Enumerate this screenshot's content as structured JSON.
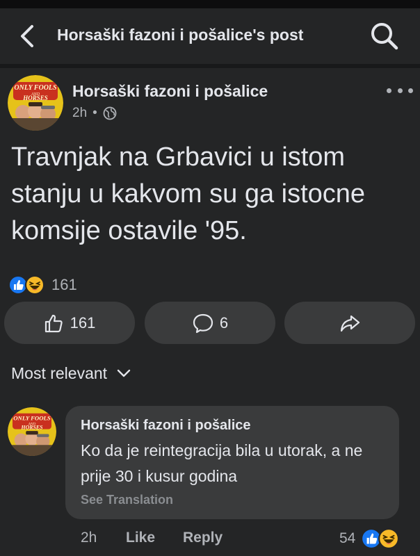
{
  "header": {
    "title": "Horsaški fazoni i pošalice's post"
  },
  "post": {
    "author": "Horsaški fazoni i pošalice",
    "time": "2h",
    "separator": "•",
    "text": "Travnjak na Grbavici u istom stanju u kakvom su ga istocne komsije ostavile '95.",
    "reaction_count": "161",
    "avatar_text": {
      "line1": "ONLY FOOLS",
      "line2": "AND",
      "line3": "HORSES"
    }
  },
  "actions": {
    "like_count": "161",
    "comment_count": "6"
  },
  "comments_sort": {
    "label": "Most relevant"
  },
  "comment": {
    "author": "Horsaški fazoni i pošalice",
    "text": "Ko da je reintegracija bila u utorak, a ne prije 30 i kusur godina",
    "see_translation": "See Translation",
    "time": "2h",
    "like_label": "Like",
    "reply_label": "Reply",
    "reaction_count": "54"
  },
  "colors": {
    "background": "#242526",
    "bubble": "#3a3b3c",
    "like_blue": "#1877f2",
    "haha_yellow": "#f7b928"
  },
  "icons": [
    "back-arrow-icon",
    "search-icon",
    "globe-icon",
    "more-dots-icon",
    "like-reaction-icon",
    "haha-reaction-icon",
    "thumbs-up-icon",
    "comment-icon",
    "share-icon",
    "chevron-down-icon"
  ]
}
